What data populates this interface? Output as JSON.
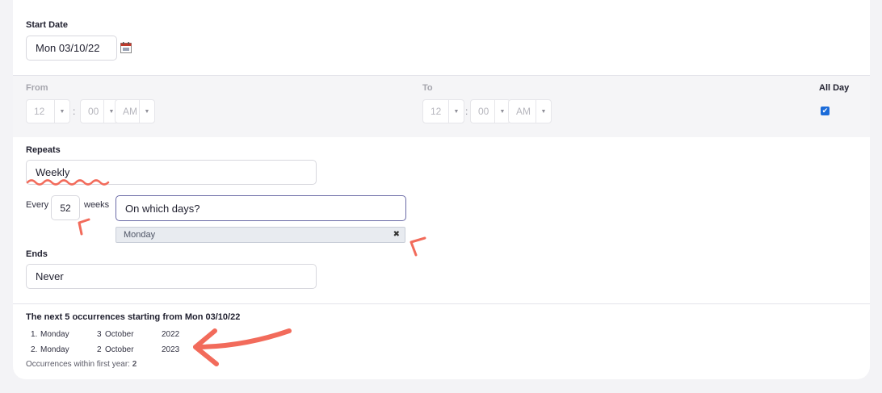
{
  "start_date": {
    "label": "Start Date",
    "value": "Mon 03/10/22"
  },
  "time_range": {
    "from_label": "From",
    "to_label": "To",
    "all_day_label": "All Day",
    "from": {
      "hour": "12",
      "minute": "00",
      "ampm": "AM"
    },
    "to": {
      "hour": "12",
      "minute": "00",
      "ampm": "AM"
    },
    "all_day_checked": true
  },
  "repeats": {
    "label": "Repeats",
    "value": "Weekly"
  },
  "interval": {
    "prefix": "Every",
    "value": "52",
    "suffix": "weeks"
  },
  "days": {
    "placeholder": "On which days?",
    "selected": "Monday"
  },
  "ends": {
    "label": "Ends",
    "value": "Never"
  },
  "occurrences": {
    "title": "The next 5 occurrences starting from Mon 03/10/22",
    "rows": [
      {
        "num": "1.",
        "weekday": "Monday",
        "day": "3",
        "month": "October",
        "year": "2022"
      },
      {
        "num": "2.",
        "weekday": "Monday",
        "day": "2",
        "month": "October",
        "year": "2023"
      }
    ],
    "summary_label": "Occurrences within first year:",
    "summary_count": "2"
  },
  "colors": {
    "accent": "#1b6bd9",
    "annotation": "#f26b5b"
  },
  "icons": [
    "calendar-icon",
    "chevron-down-icon",
    "checkmark-icon",
    "close-icon"
  ]
}
